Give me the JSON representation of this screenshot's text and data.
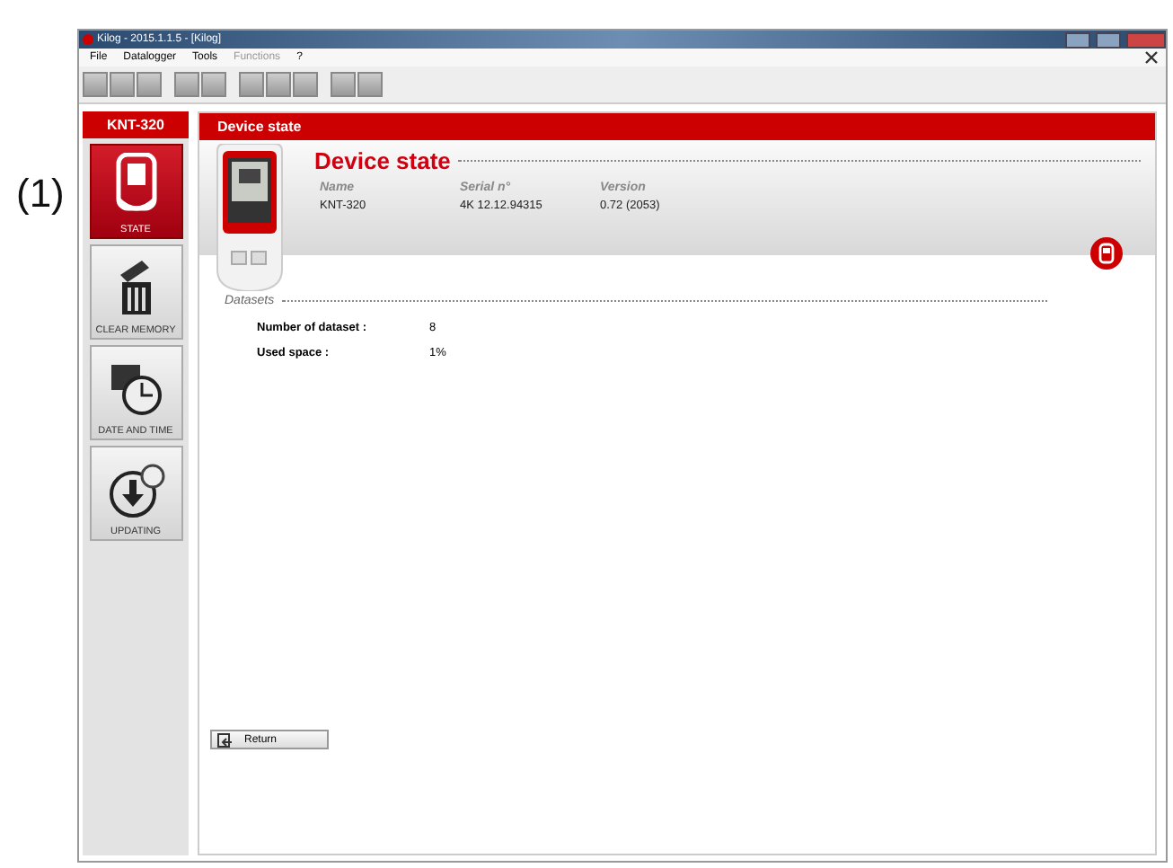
{
  "annotation": "(1)",
  "window": {
    "title": "Kilog - 2015.1.1.5 - [Kilog]"
  },
  "menu": [
    {
      "label": "File",
      "disabled": false
    },
    {
      "label": "Datalogger",
      "disabled": false
    },
    {
      "label": "Tools",
      "disabled": false
    },
    {
      "label": "Functions",
      "disabled": true
    },
    {
      "label": "?",
      "disabled": false
    }
  ],
  "sidebar": {
    "title": "KNT-320",
    "items": [
      {
        "kind": "state",
        "label": "STATE",
        "selected": true
      },
      {
        "kind": "clear",
        "label": "CLEAR MEMORY",
        "selected": false
      },
      {
        "kind": "date",
        "label": "DATE AND TIME",
        "selected": false
      },
      {
        "kind": "update",
        "label": "UPDATING",
        "selected": false
      }
    ]
  },
  "panel": {
    "header": "Device state",
    "title": "Device state",
    "info": [
      {
        "label": "Name",
        "value": "KNT-320"
      },
      {
        "label": "Serial n°",
        "value": "4K 12.12.94315"
      },
      {
        "label": "Version",
        "value": "0.72 (2053)"
      }
    ],
    "datasets": {
      "title": "Datasets",
      "rows": [
        {
          "label": "Number of dataset :",
          "value": "8"
        },
        {
          "label": "Used space :",
          "value": "1%"
        }
      ]
    },
    "return_button": "Return"
  }
}
